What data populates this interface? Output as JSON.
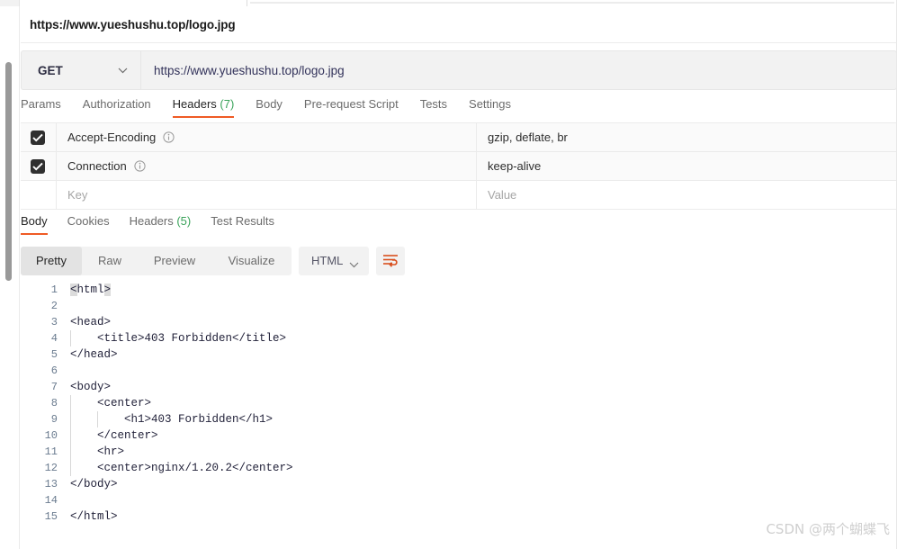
{
  "request": {
    "title_url": "https://www.yueshushu.top/logo.jpg",
    "method": "GET",
    "method_chevron": "chevron-down-icon",
    "url_value": "https://www.yueshushu.top/logo.jpg",
    "tabs": [
      {
        "label": "Params",
        "count": "",
        "active": false
      },
      {
        "label": "Authorization",
        "count": "",
        "active": false
      },
      {
        "label": "Headers",
        "count": " (7)",
        "active": true
      },
      {
        "label": "Body",
        "count": "",
        "active": false
      },
      {
        "label": "Pre-request Script",
        "count": "",
        "active": false
      },
      {
        "label": "Tests",
        "count": "",
        "active": false
      },
      {
        "label": "Settings",
        "count": "",
        "active": false
      }
    ]
  },
  "headers_table": {
    "rows": [
      {
        "checked": true,
        "key": "Accept-Encoding",
        "value": "gzip, deflate, br",
        "info": "info-icon",
        "placeholder": false
      },
      {
        "checked": true,
        "key": "Connection",
        "value": "keep-alive",
        "info": "info-icon",
        "placeholder": false
      },
      {
        "checked": false,
        "key": "Key",
        "value": "Value",
        "info": "",
        "placeholder": true
      }
    ]
  },
  "response": {
    "tabs": [
      {
        "label": "Body",
        "count": "",
        "active": true
      },
      {
        "label": "Cookies",
        "count": "",
        "active": false
      },
      {
        "label": "Headers",
        "count": " (5)",
        "active": false
      },
      {
        "label": "Test Results",
        "count": "",
        "active": false
      }
    ],
    "view_modes": [
      {
        "label": "Pretty",
        "active": true
      },
      {
        "label": "Raw",
        "active": false
      },
      {
        "label": "Preview",
        "active": false
      },
      {
        "label": "Visualize",
        "active": false
      }
    ],
    "format": "HTML",
    "format_chevron": "chevron-down-icon",
    "wrap_button": "wrap-text-icon"
  },
  "code": {
    "lines": [
      {
        "n": "1",
        "text": "<html>",
        "indent": 0,
        "highlight_brackets": true
      },
      {
        "n": "2",
        "text": "",
        "indent": 0
      },
      {
        "n": "3",
        "text": "<head>",
        "indent": 0
      },
      {
        "n": "4",
        "text": "    <title>403 Forbidden</title>",
        "indent": 1
      },
      {
        "n": "5",
        "text": "</head>",
        "indent": 0
      },
      {
        "n": "6",
        "text": "",
        "indent": 0
      },
      {
        "n": "7",
        "text": "<body>",
        "indent": 0
      },
      {
        "n": "8",
        "text": "    <center>",
        "indent": 1
      },
      {
        "n": "9",
        "text": "        <h1>403 Forbidden</h1>",
        "indent": 2
      },
      {
        "n": "10",
        "text": "    </center>",
        "indent": 1
      },
      {
        "n": "11",
        "text": "    <hr>",
        "indent": 1
      },
      {
        "n": "12",
        "text": "    <center>nginx/1.20.2</center>",
        "indent": 1
      },
      {
        "n": "13",
        "text": "</body>",
        "indent": 0
      },
      {
        "n": "14",
        "text": "",
        "indent": 0
      },
      {
        "n": "15",
        "text": "</html>",
        "indent": 0
      }
    ]
  },
  "watermark": {
    "text": "CSDN @两个蝴蝶飞"
  },
  "colors": {
    "accent_orange": "#ef5b25",
    "count_green": "#3aa35a",
    "code_text": "#22223a",
    "line_number": "#6a7b8f"
  }
}
